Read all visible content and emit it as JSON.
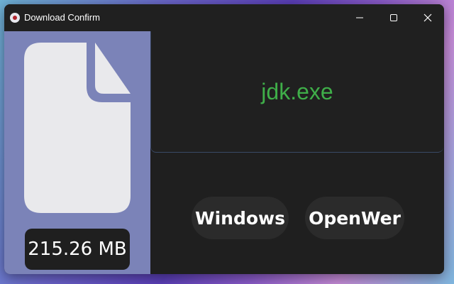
{
  "window": {
    "title": "Download Confirm",
    "controls": {
      "minimize_icon": "minimize-icon",
      "maximize_icon": "maximize-icon",
      "close_icon": "close-icon"
    }
  },
  "file": {
    "icon": "file-icon",
    "size": "215.26 MB",
    "name": "jdk.exe"
  },
  "actions": {
    "windows_label": "Windows",
    "openwer_label": "OpenWer"
  },
  "colors": {
    "left_panel": "#7b83b8",
    "window_bg": "#1f1f1f",
    "file_name": "#3fae49",
    "button_bg": "#2b2b2b"
  }
}
